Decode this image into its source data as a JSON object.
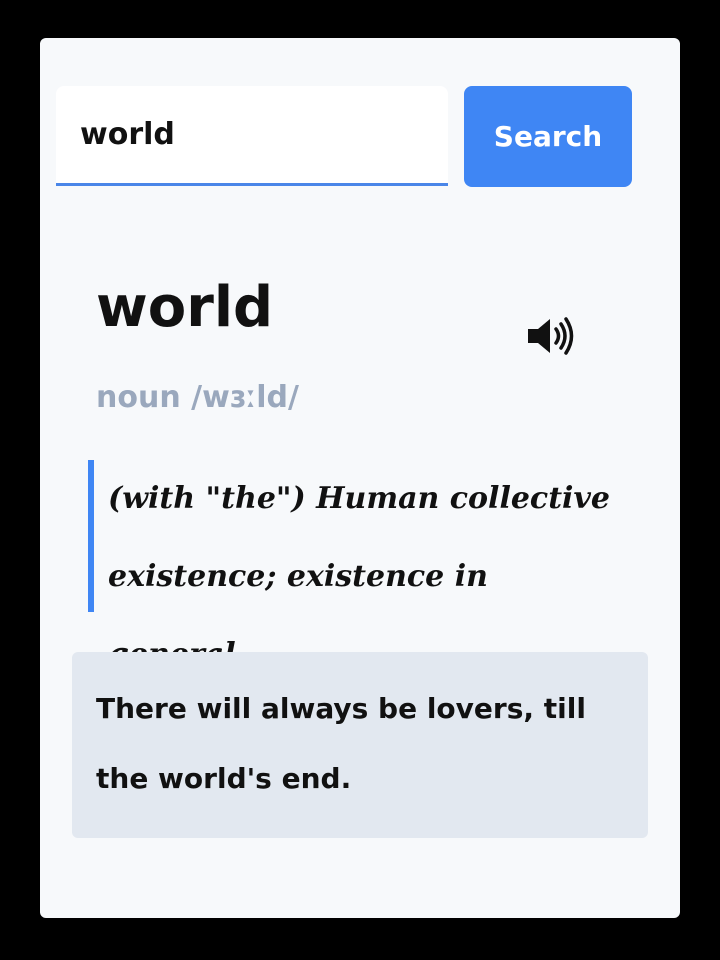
{
  "search": {
    "value": "world",
    "button_label": "Search"
  },
  "entry": {
    "word": "world",
    "audio_icon": "speaker-icon",
    "pos_phonetic": "noun /wɜːld/",
    "definition": "(with \"the\") Human collective existence; existence in general.",
    "example": "There will always be lovers, till the world's end."
  },
  "colors": {
    "accent": "#3f86f4",
    "muted_text": "#9aa8bd",
    "card_bg": "#f7f9fb",
    "example_bg": "#e2e8f0"
  }
}
